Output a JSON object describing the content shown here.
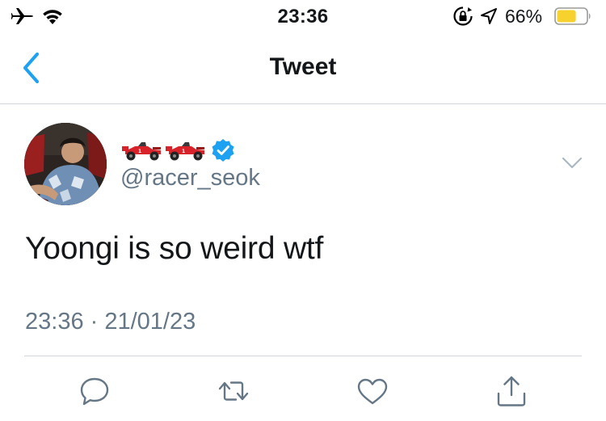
{
  "status_bar": {
    "time": "23:36",
    "battery_percent": "66%",
    "battery_level": 0.66,
    "battery_color": "#f7d12e",
    "icons": [
      "airplane-icon",
      "wifi-icon",
      "orientation-lock-icon",
      "location-arrow-icon",
      "battery-icon"
    ]
  },
  "nav": {
    "title": "Tweet",
    "back_icon": "chevron-left-icon",
    "accent_color": "#1da1f2"
  },
  "tweet": {
    "display_name_icons": [
      "race-car-icon",
      "race-car-icon"
    ],
    "verified": true,
    "handle": "@racer_seok",
    "text": "Yoongi is so weird wtf",
    "timestamp": "23:36 · 21/01/23",
    "menu_icon": "chevron-down-icon"
  },
  "actions": [
    {
      "name": "reply",
      "icon": "speech-bubble-icon"
    },
    {
      "name": "retweet",
      "icon": "retweet-icon"
    },
    {
      "name": "like",
      "icon": "heart-icon"
    },
    {
      "name": "share",
      "icon": "share-icon"
    }
  ],
  "colors": {
    "text": "#14171a",
    "secondary_text": "#657786",
    "icon_gray": "#657786",
    "divider": "#d2d6da",
    "verified": "#1da1f2"
  }
}
